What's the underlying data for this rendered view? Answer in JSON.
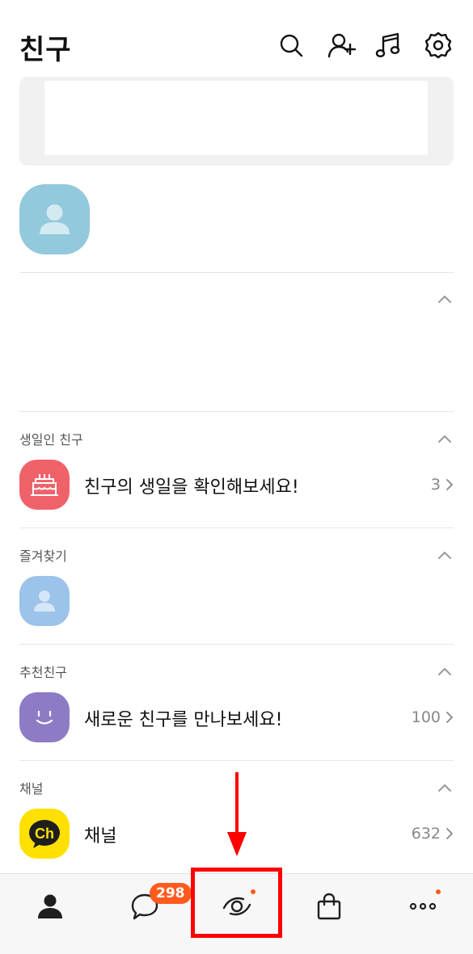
{
  "header": {
    "title": "친구",
    "icons": [
      "search-icon",
      "add-friend-icon",
      "music-icon",
      "settings-icon"
    ]
  },
  "sections": {
    "birthday": {
      "title": "생일인 친구",
      "row_text": "친구의 생일을 확인해보세요!",
      "count": "3",
      "icon_color": "#f0626a"
    },
    "favorites": {
      "title": "즐겨찾기",
      "icon_color": "#9cc3ea"
    },
    "recommended": {
      "title": "추천친구",
      "row_text": "새로운 친구를 만나보세요!",
      "count": "100",
      "icon_color": "#8d7bc6"
    },
    "channel": {
      "title": "채널",
      "row_text": "채널",
      "count": "632",
      "icon_text": "Ch",
      "icon_color": "#ffe000"
    }
  },
  "tabbar": {
    "tabs": [
      "friends-tab",
      "chats-tab",
      "view-tab",
      "shopping-tab",
      "more-tab"
    ],
    "chat_badge": "298",
    "accent": "#ff5b1f"
  },
  "annotation": {
    "color": "#ff0000",
    "target": "view-tab"
  }
}
